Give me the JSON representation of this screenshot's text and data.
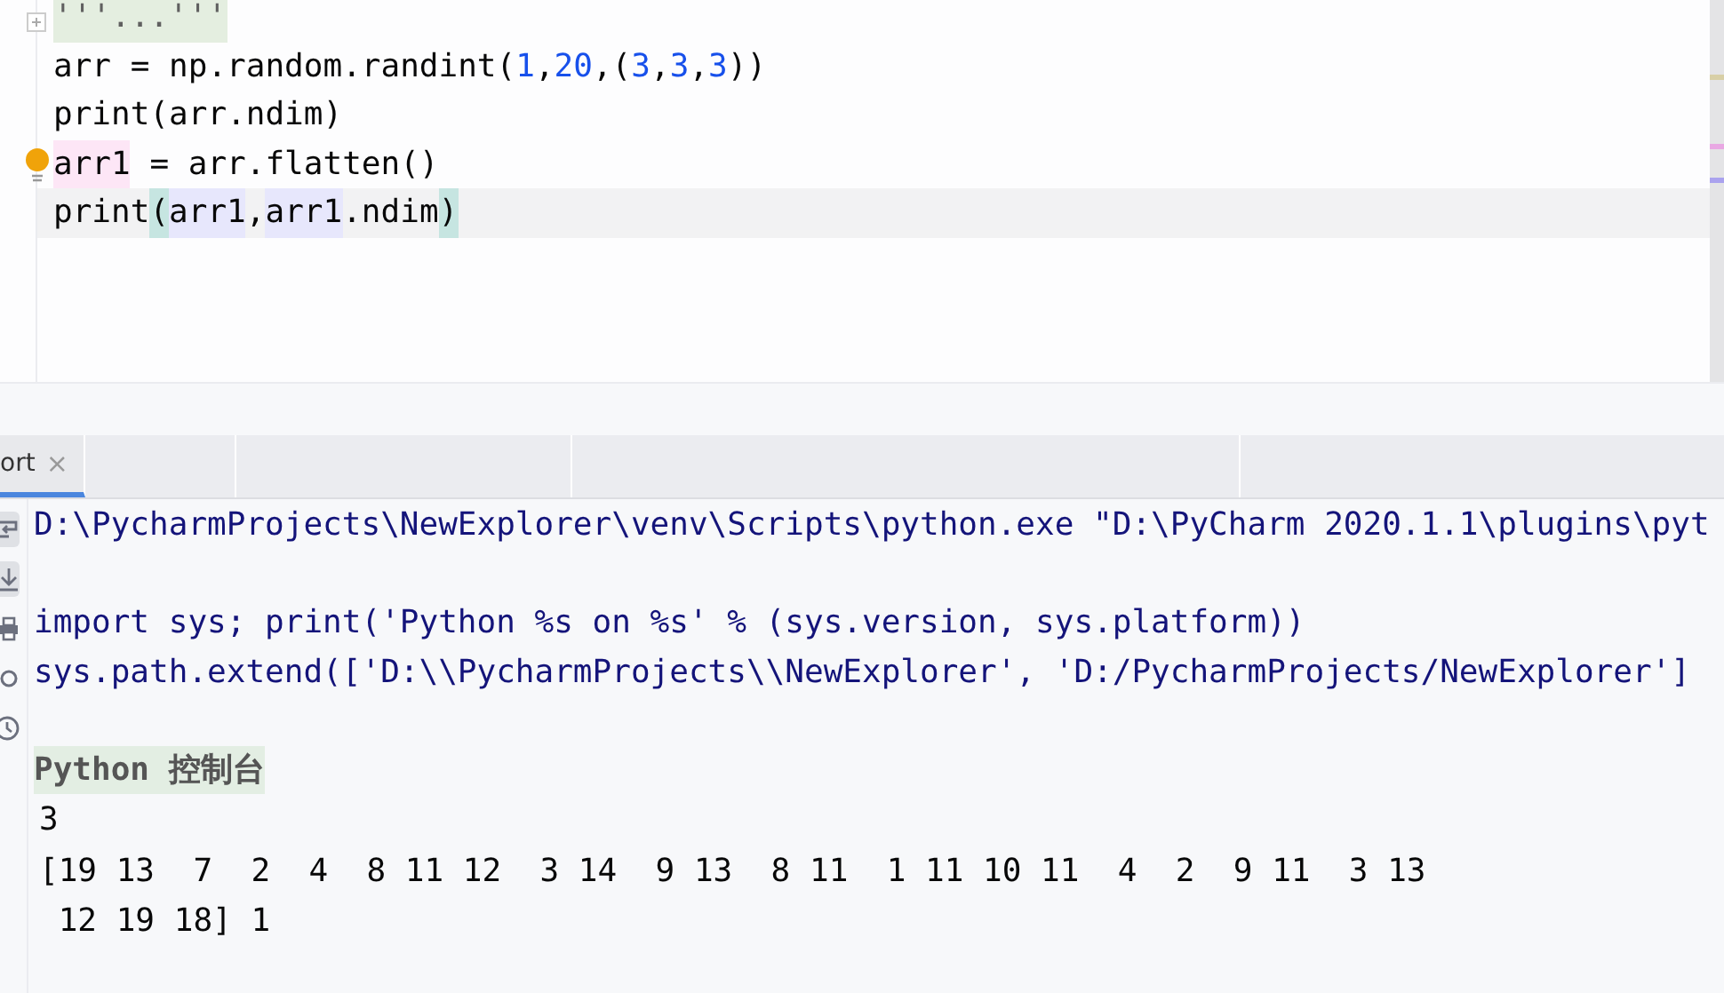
{
  "editor": {
    "lines": [
      {
        "current": false,
        "bulb": false,
        "tokens": [
          {
            "text": "'''...'''",
            "kind": "docstring"
          }
        ]
      },
      {
        "current": false,
        "bulb": false,
        "tokens": [
          {
            "text": "arr = np.random.randint(",
            "kind": "plain"
          },
          {
            "text": "1",
            "kind": "number"
          },
          {
            "text": ",",
            "kind": "plain"
          },
          {
            "text": "20",
            "kind": "number"
          },
          {
            "text": ",(",
            "kind": "plain"
          },
          {
            "text": "3",
            "kind": "number"
          },
          {
            "text": ",",
            "kind": "plain"
          },
          {
            "text": "3",
            "kind": "number"
          },
          {
            "text": ",",
            "kind": "plain"
          },
          {
            "text": "3",
            "kind": "number"
          },
          {
            "text": "))",
            "kind": "plain"
          }
        ]
      },
      {
        "current": false,
        "bulb": false,
        "tokens": [
          {
            "text": "print(arr.ndim)",
            "kind": "plain"
          }
        ]
      },
      {
        "current": false,
        "bulb": true,
        "tokens": [
          {
            "text": "arr1",
            "kind": "write"
          },
          {
            "text": " = arr.flatten()",
            "kind": "plain"
          }
        ]
      },
      {
        "current": true,
        "bulb": false,
        "tokens": [
          {
            "text": "print",
            "kind": "plain"
          },
          {
            "text": "(",
            "kind": "brace"
          },
          {
            "text": "arr1",
            "kind": "read"
          },
          {
            "text": ",",
            "kind": "plain"
          },
          {
            "text": "arr1",
            "kind": "read"
          },
          {
            "text": ".ndim",
            "kind": "plain"
          },
          {
            "text": ")",
            "kind": "brace"
          }
        ]
      }
    ]
  },
  "console": {
    "tabs": [
      {
        "label": "ort",
        "close": "×",
        "selected": true
      }
    ],
    "lines": [
      {
        "kind": "command",
        "text": "D:\\PycharmProjects\\NewExplorer\\venv\\Scripts\\python.exe \"D:\\PyCharm 2020.1.1\\plugins\\pyt"
      },
      {
        "kind": "blank"
      },
      {
        "kind": "command",
        "text": "import sys; print('Python %s on %s' % (sys.version, sys.platform))"
      },
      {
        "kind": "command",
        "text": "sys.path.extend(['D:\\\\PycharmProjects\\\\NewExplorer', 'D:/PycharmProjects/NewExplorer']"
      },
      {
        "kind": "blank"
      },
      {
        "kind": "banner",
        "text": "Python 控制台"
      },
      {
        "kind": "output",
        "text": "3"
      },
      {
        "kind": "output",
        "text": "[19 13  7  2  4  8 11 12  3 14  9 13  8 11  1 11 10 11  4  2  9 11  3 13"
      },
      {
        "kind": "output",
        "text": " 12 19 18] 1"
      }
    ]
  }
}
